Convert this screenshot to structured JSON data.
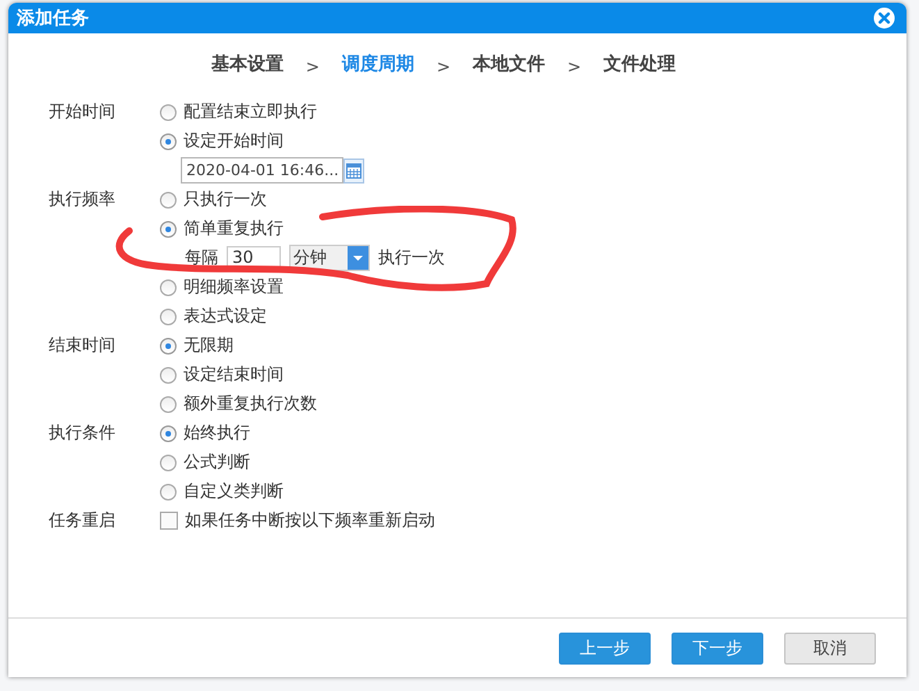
{
  "window": {
    "title": "添加任务"
  },
  "steps": [
    {
      "label": "基本设置",
      "selected": false
    },
    {
      "label": "调度周期",
      "selected": true
    },
    {
      "label": "本地文件",
      "selected": false
    },
    {
      "label": "文件处理",
      "selected": false
    }
  ],
  "step_separators": [
    ">",
    ">",
    ">"
  ],
  "sections": [
    {
      "label": "开始时间",
      "options": [
        {
          "kind": "radio",
          "label": "配置结束立即执行",
          "selected": false
        },
        {
          "kind": "radio",
          "label": "设定开始时间",
          "selected": true
        },
        {
          "kind": "date",
          "value": "2020-04-01 16:46..."
        }
      ]
    },
    {
      "label": "执行频率",
      "options": [
        {
          "kind": "radio",
          "label": "只执行一次",
          "selected": false
        },
        {
          "kind": "radio",
          "label": "简单重复执行",
          "selected": true
        },
        {
          "kind": "interval",
          "prefix": "每隔",
          "value": "30",
          "unit": "分钟",
          "suffix": "执行一次"
        },
        {
          "kind": "radio",
          "label": "明细频率设置",
          "selected": false
        },
        {
          "kind": "radio",
          "label": "表达式设定",
          "selected": false
        }
      ]
    },
    {
      "label": "结束时间",
      "options": [
        {
          "kind": "radio",
          "label": "无限期",
          "selected": true
        },
        {
          "kind": "radio",
          "label": "设定结束时间",
          "selected": false
        },
        {
          "kind": "radio",
          "label": "额外重复执行次数",
          "selected": false
        }
      ]
    },
    {
      "label": "执行条件",
      "options": [
        {
          "kind": "radio",
          "label": "始终执行",
          "selected": true
        },
        {
          "kind": "radio",
          "label": "公式判断",
          "selected": false
        },
        {
          "kind": "radio",
          "label": "自定义类判断",
          "selected": false
        }
      ]
    },
    {
      "label": "任务重启",
      "options": [
        {
          "kind": "checkbox",
          "label": "如果任务中断按以下频率重新启动",
          "checked": false
        }
      ]
    }
  ],
  "buttons": [
    {
      "label": "上一步",
      "kind": "primary"
    },
    {
      "label": "下一步",
      "kind": "primary"
    },
    {
      "label": "取消",
      "kind": "secondary"
    }
  ]
}
